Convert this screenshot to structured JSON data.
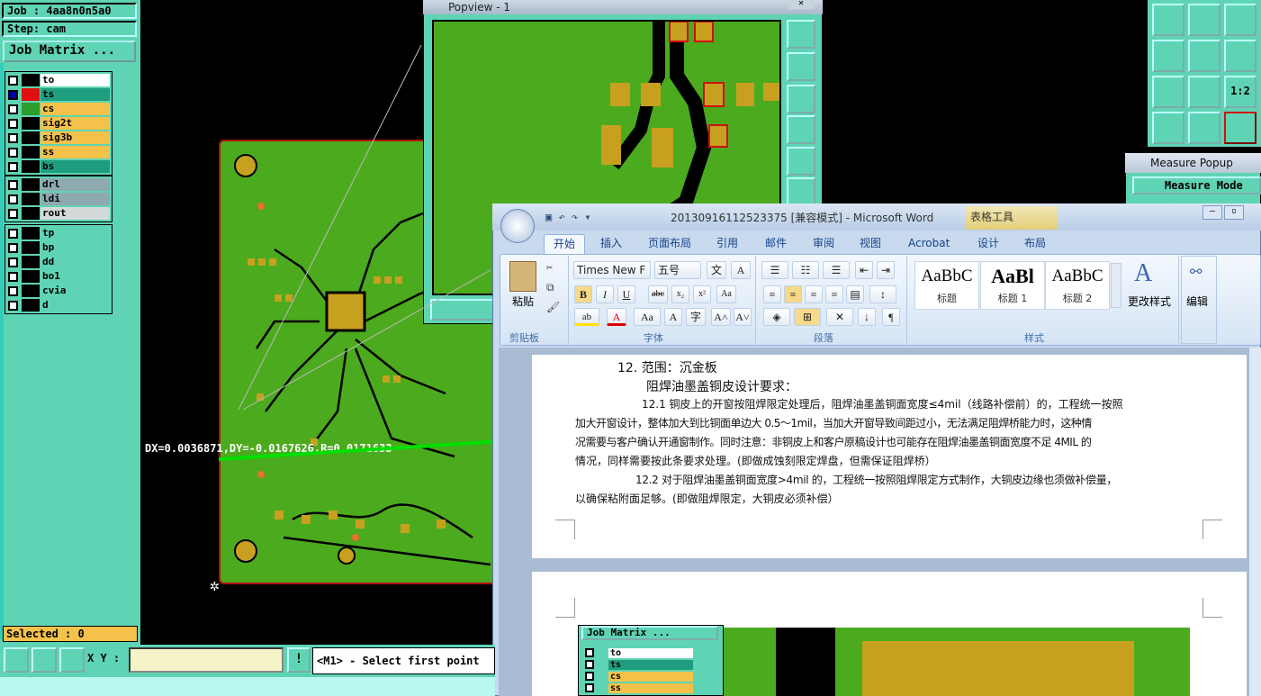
{
  "left_panel": {
    "job": "Job : 4aa8n0n5a0",
    "step": "Step: cam",
    "job_matrix": "Job Matrix ...",
    "selected": "Selected : 0",
    "layer_groups": [
      {
        "layers": [
          {
            "name": "to",
            "swatch": "#000000",
            "color": "#ffffff"
          },
          {
            "name": "ts",
            "swatch": "#e01010",
            "color": "#1e9e7e",
            "selected": true
          },
          {
            "name": "cs",
            "swatch": "#2c9e2c",
            "color": "#f4c24a"
          },
          {
            "name": "sig2t",
            "swatch": "#000000",
            "color": "#f4c24a"
          },
          {
            "name": "sig3b",
            "swatch": "#000000",
            "color": "#f4c24a"
          },
          {
            "name": "ss",
            "swatch": "#000000",
            "color": "#f4c24a"
          },
          {
            "name": "bs",
            "swatch": "#000000",
            "color": "#1e9e7e"
          }
        ]
      },
      {
        "layers": [
          {
            "name": "drl",
            "swatch": "#000000",
            "color": "#8fa9b0"
          },
          {
            "name": "ldi",
            "swatch": "#000000",
            "color": "#8fa9b0"
          },
          {
            "name": "rout",
            "swatch": "#000000",
            "color": "#d4dada"
          }
        ]
      },
      {
        "layers": [
          {
            "name": "tp",
            "swatch": "#000000",
            "color": "#5fd4b4"
          },
          {
            "name": "bp",
            "swatch": "#000000",
            "color": "#5fd4b4"
          },
          {
            "name": "dd",
            "swatch": "#000000",
            "color": "#5fd4b4"
          },
          {
            "name": "bo1",
            "swatch": "#000000",
            "color": "#5fd4b4"
          },
          {
            "name": "cvia",
            "swatch": "#000000",
            "color": "#5fd4b4"
          },
          {
            "name": "d",
            "swatch": "#000000",
            "color": "#5fd4b4"
          }
        ]
      }
    ]
  },
  "bottom_bar": {
    "xy_label": "X Y :",
    "xy_value": "",
    "warn": "!",
    "prompt": "<M1> - Select first point"
  },
  "measure_readout": "DX=0.0036871,DY=-0.0167626,R=0.0171633",
  "popview": {
    "title": "Popview - 1"
  },
  "measure_popup": {
    "title": "Measure Popup",
    "mode": "Measure Mode"
  },
  "word": {
    "title": "20130916112523375 [兼容模式] - Microsoft Word",
    "context_tab": "表格工具",
    "tabs": [
      "开始",
      "插入",
      "页面布局",
      "引用",
      "邮件",
      "审阅",
      "视图",
      "Acrobat",
      "设计",
      "布局"
    ],
    "font_name": "Times New F",
    "font_size": "五号",
    "clipboard": {
      "paste": "粘贴",
      "group": "剪贴板"
    },
    "font_group": "字体",
    "paragraph_group": "段落",
    "styles_group": "样式",
    "styles": [
      {
        "sample": "AaBbC",
        "name": "标题"
      },
      {
        "sample": "AaBl",
        "name": "标题 1"
      },
      {
        "sample": "AaBbC",
        "name": "标题 2"
      }
    ],
    "change_styles": "更改样式",
    "edit": "编辑",
    "doc": {
      "heading": "12. 范围：沉金板",
      "subheading": "阻焊油墨盖铜皮设计要求：",
      "p1_l1": "12.1 铜皮上的开窗按阻焊限定处理后，阻焊油墨盖铜面宽度≤4mil（线路补偿前）的，工程统一按照",
      "p1_l2": "加大开窗设计，整体加大到比铜面单边大 0.5～1mil，当加大开窗导致间距过小，无法满足阻焊桥能力时，这种情",
      "p1_l3": "况需要与客户确认开通窗制作。同时注意：非铜皮上和客户原稿设计也可能存在阻焊油墨盖铜面宽度不足 4MIL 的",
      "p1_l4": "情况，同样需要按此条要求处理。(即做成蚀刻限定焊盘，但需保证阻焊桥）",
      "p2_l1": "12.2 对于阻焊油墨盖铜面宽度>4mil 的，工程统一按照阻焊限定方式制作，大铜皮边缘也须做补偿量，",
      "p2_l2": "以确保粘附面足够。(即做阻焊限定，大铜皮必须补偿）"
    },
    "embedded": {
      "job_matrix": "Job Matrix ...",
      "layers": [
        {
          "name": "to",
          "color": "#ffffff"
        },
        {
          "name": "ts",
          "color": "#1e9e7e"
        },
        {
          "name": "cs",
          "color": "#f4c24a"
        },
        {
          "name": "ss",
          "color": "#f4c24a"
        }
      ]
    }
  },
  "colors": {
    "panel": "#5fd4b4",
    "board": "#4caa1e",
    "pad": "#c8a020",
    "trace": "#000000",
    "measure": "#00e000"
  }
}
